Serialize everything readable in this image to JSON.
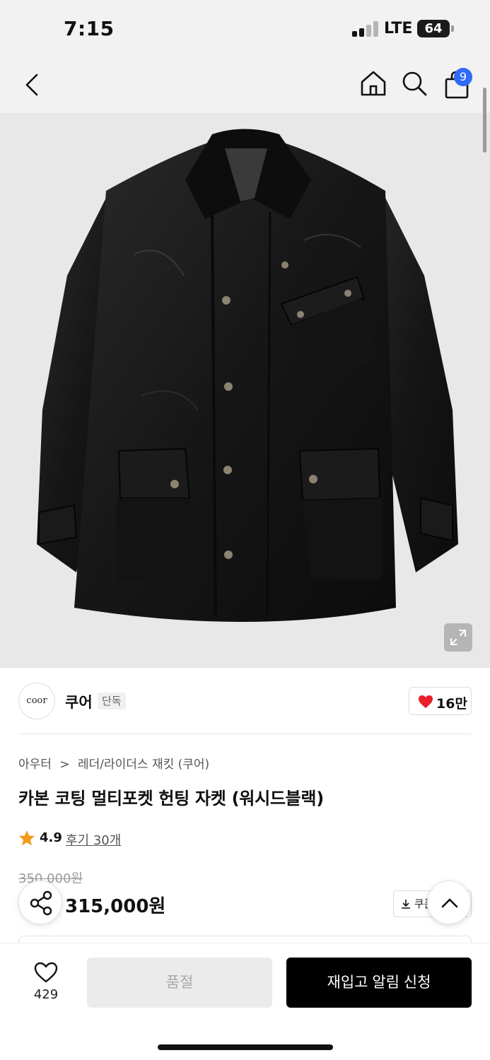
{
  "status_bar": {
    "time": "7:15",
    "network": "LTE",
    "battery": "64"
  },
  "nav": {
    "back_icon": "chevron-left-icon",
    "home_icon": "home-icon",
    "search_icon": "search-icon",
    "cart_icon": "shopping-bag-icon",
    "cart_count": "9"
  },
  "product_image": {
    "subject": "jacket",
    "expand_icon": "expand-icon"
  },
  "brand": {
    "logo_text": "coor",
    "name": "쿠어",
    "tag": "단독",
    "likes": "16만"
  },
  "breadcrumb": {
    "category": "아우터",
    "separator": ">",
    "subcategory": "레더/라이더스 재킷 (쿠어)"
  },
  "product": {
    "title": "카본 코팅 멀티포켓 헌팅 자켓 (워시드블랙)",
    "rating": "4.9",
    "reviews": "후기 30개",
    "original_price": "350,000원",
    "sale_price": "315,000원"
  },
  "actions": {
    "coupon_label": "쿠폰",
    "wish_count": "429",
    "soldout_label": "품절",
    "restock_label": "재입고 알림 신청"
  },
  "colors": {
    "accent": "#2f6bf6",
    "heart": "#e8202a",
    "star": "#f29a1c",
    "primary_button": "#000000"
  }
}
